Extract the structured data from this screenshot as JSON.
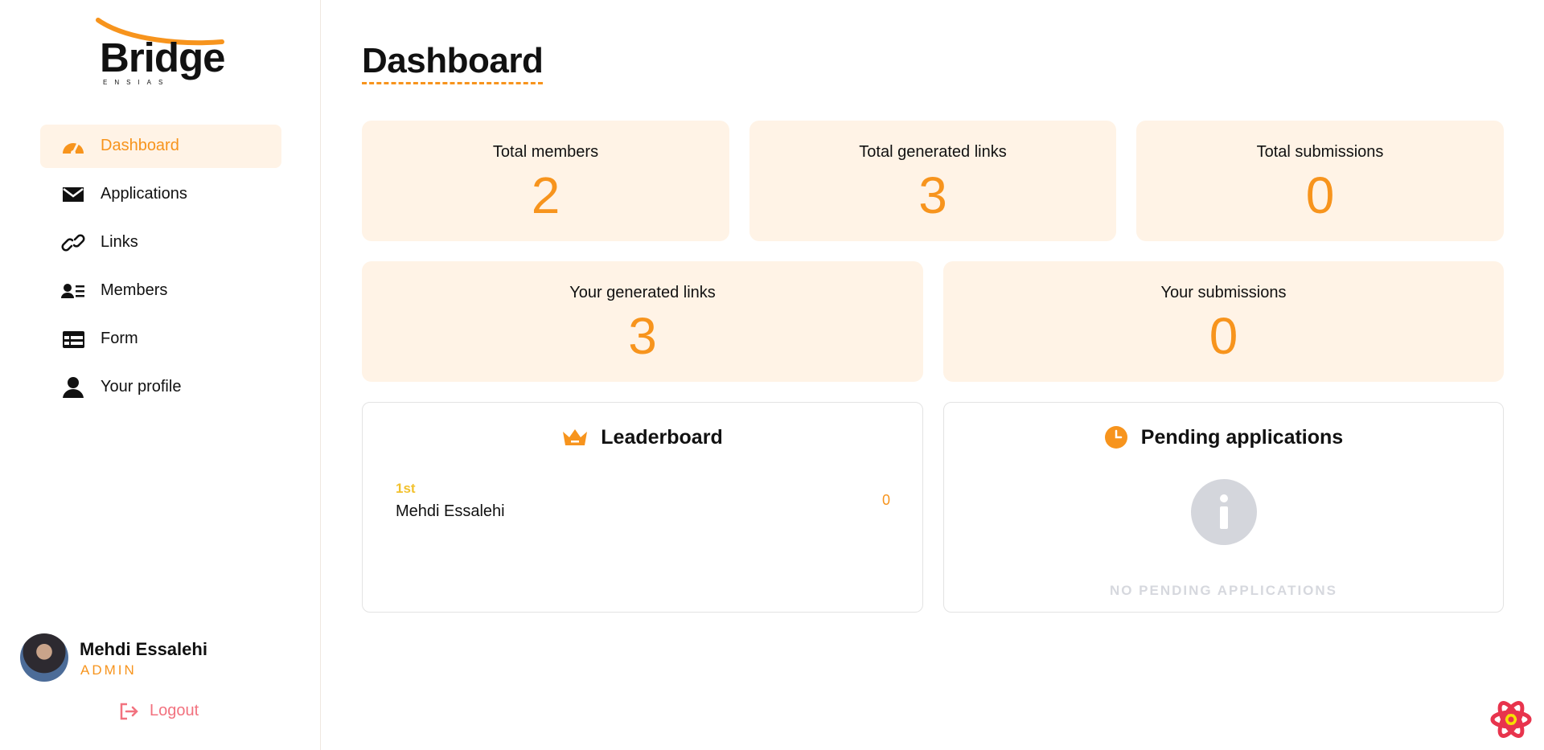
{
  "brand": {
    "logo_text": "Bridge",
    "logo_subtext": "ENSIAS",
    "accent_color": "#f7941d",
    "active_bg": "#fff3e6"
  },
  "sidebar": {
    "items": [
      {
        "label": "Dashboard",
        "icon": "speedometer-icon",
        "active": true
      },
      {
        "label": "Applications",
        "icon": "envelope-icon",
        "active": false
      },
      {
        "label": "Links",
        "icon": "link-icon",
        "active": false
      },
      {
        "label": "Members",
        "icon": "member-list-icon",
        "active": false
      },
      {
        "label": "Form",
        "icon": "table-form-icon",
        "active": false
      },
      {
        "label": "Your profile",
        "icon": "user-icon",
        "active": false
      }
    ]
  },
  "user": {
    "name": "Mehdi Essalehi",
    "role": "ADMIN"
  },
  "logout": {
    "label": "Logout",
    "icon": "logout-icon",
    "color": "#f2727f"
  },
  "main": {
    "title": "Dashboard",
    "stats_row1": [
      {
        "label": "Total members",
        "value": "2"
      },
      {
        "label": "Total generated links",
        "value": "3"
      },
      {
        "label": "Total submissions",
        "value": "0"
      }
    ],
    "stats_row2": [
      {
        "label": "Your generated links",
        "value": "3"
      },
      {
        "label": "Your submissions",
        "value": "0"
      }
    ],
    "leaderboard": {
      "title": "Leaderboard",
      "icon": "crown-icon",
      "entries": [
        {
          "rank": "1st",
          "name": "Mehdi Essalehi",
          "score": "0"
        }
      ]
    },
    "pending": {
      "title": "Pending applications",
      "icon": "clock-icon",
      "empty_icon": "info-icon",
      "empty_text": "NO PENDING APPLICATIONS"
    }
  }
}
